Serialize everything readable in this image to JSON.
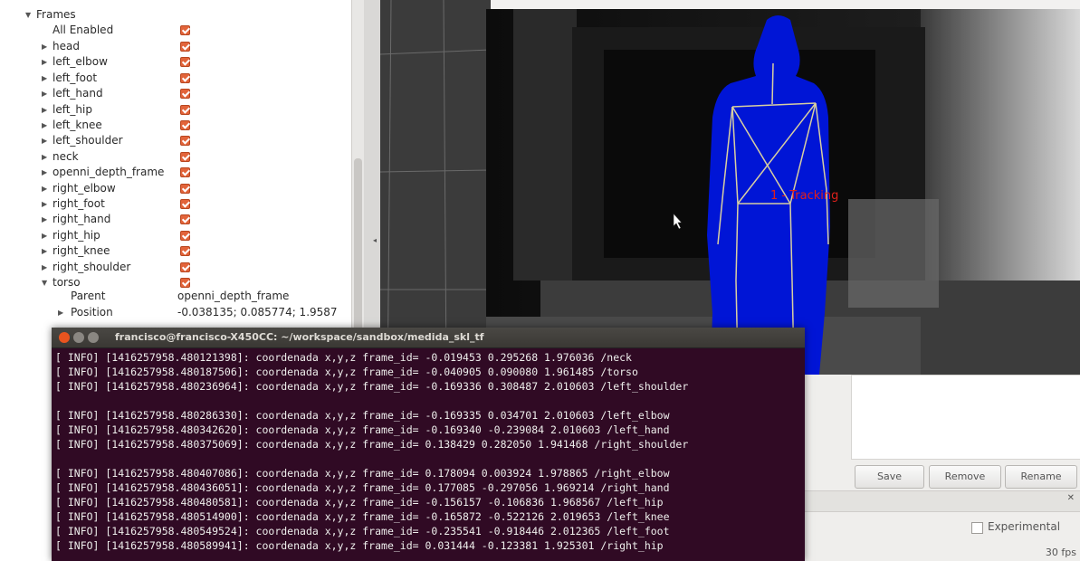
{
  "tree": {
    "frames_label": "Frames",
    "all_enabled_label": "All Enabled",
    "items": [
      "head",
      "left_elbow",
      "left_foot",
      "left_hand",
      "left_hip",
      "left_knee",
      "left_shoulder",
      "neck",
      "openni_depth_frame",
      "right_elbow",
      "right_foot",
      "right_hand",
      "right_hip",
      "right_knee",
      "right_shoulder",
      "torso"
    ],
    "parent_label": "Parent",
    "parent_value": "openni_depth_frame",
    "position_label": "Position",
    "position_value": "-0.038135; 0.085774; 1.9587"
  },
  "depth_view": {
    "overlay_text": "1 - Tracking",
    "overlay_color": "#e0201b",
    "person_color": "#0015d6",
    "skeleton_color": "#d8cfa0"
  },
  "right_panel": {
    "save_label": "Save",
    "remove_label": "Remove",
    "rename_label": "Rename",
    "experimental_label": "Experimental",
    "fps_label": "30 fps"
  },
  "terminal": {
    "title": "francisco@francisco-X450CC: ~/workspace/sandbox/medida_skl_tf",
    "lines": [
      "[ INFO] [1416257958.480121398]: coordenada x,y,z frame_id= -0.019453 0.295268 1.976036 /neck",
      "[ INFO] [1416257958.480187506]: coordenada x,y,z frame_id= -0.040905 0.090080 1.961485 /torso",
      "[ INFO] [1416257958.480236964]: coordenada x,y,z frame_id= -0.169336 0.308487 2.010603 /left_shoulder",
      "",
      "[ INFO] [1416257958.480286330]: coordenada x,y,z frame_id= -0.169335 0.034701 2.010603 /left_elbow",
      "[ INFO] [1416257958.480342620]: coordenada x,y,z frame_id= -0.169340 -0.239084 2.010603 /left_hand",
      "[ INFO] [1416257958.480375069]: coordenada x,y,z frame_id= 0.138429 0.282050 1.941468 /right_shoulder",
      "",
      "[ INFO] [1416257958.480407086]: coordenada x,y,z frame_id= 0.178094 0.003924 1.978865 /right_elbow",
      "[ INFO] [1416257958.480436051]: coordenada x,y,z frame_id= 0.177085 -0.297056 1.969214 /right_hand",
      "[ INFO] [1416257958.480480581]: coordenada x,y,z frame_id= -0.156157 -0.106836 1.968567 /left_hip",
      "[ INFO] [1416257958.480514900]: coordenada x,y,z frame_id= -0.165872 -0.522126 2.019653 /left_knee",
      "[ INFO] [1416257958.480549524]: coordenada x,y,z frame_id= -0.235541 -0.918446 2.012365 /left_foot",
      "[ INFO] [1416257958.480589941]: coordenada x,y,z frame_id= 0.031444 -0.123381 1.925301 /right_hip"
    ]
  }
}
